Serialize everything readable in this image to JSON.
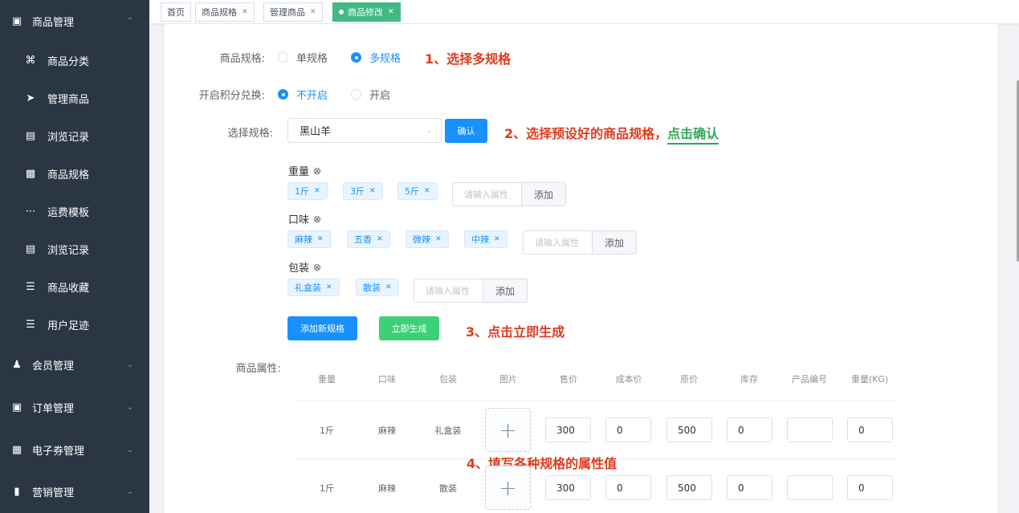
{
  "sidebar": {
    "top_group": {
      "label": "商品管理",
      "icon": "box-icon"
    },
    "sub_items": [
      {
        "label": "商品分类",
        "icon": "category-icon"
      },
      {
        "label": "管理商品",
        "icon": "send-icon"
      },
      {
        "label": "浏览记录",
        "icon": "history-icon"
      },
      {
        "label": "商品规格",
        "icon": "monitor-icon"
      },
      {
        "label": "运费模板",
        "icon": "shrink-icon"
      },
      {
        "label": "浏览记录",
        "icon": "history-icon"
      },
      {
        "label": "商品收藏",
        "icon": "menu-icon"
      },
      {
        "label": "用户足迹",
        "icon": "list-icon"
      }
    ],
    "groups": [
      {
        "label": "会员管理",
        "icon": "users-icon"
      },
      {
        "label": "订单管理",
        "icon": "lock-icon"
      },
      {
        "label": "电子券管理",
        "icon": "coupon-icon"
      },
      {
        "label": "营销管理",
        "icon": "chart-icon"
      }
    ]
  },
  "tabs": [
    {
      "label": "首页",
      "closable": false
    },
    {
      "label": "商品规格",
      "closable": true
    },
    {
      "label": "管理商品",
      "closable": true
    },
    {
      "label": "商品修改",
      "closable": true,
      "active": true
    }
  ],
  "form": {
    "spec_type_label": "商品规格:",
    "spec_type_options": [
      "单规格",
      "多规格"
    ],
    "spec_type_selected": "多规格",
    "points_label": "开启积分兑换:",
    "points_options": [
      "不开启",
      "开启"
    ],
    "points_selected": "不开启",
    "choose_spec_label": "选择规格:",
    "choose_spec_value": "黑山羊",
    "confirm_label": "确认",
    "specs": [
      {
        "name": "重量",
        "values": [
          "1斤",
          "3斤",
          "5斤"
        ]
      },
      {
        "name": "口味",
        "values": [
          "麻辣",
          "五香",
          "微辣",
          "中辣"
        ]
      },
      {
        "name": "包装",
        "values": [
          "礼盒装",
          "散装"
        ]
      }
    ],
    "attr_placeholder": "请输入属性",
    "add_label": "添加",
    "add_spec_label": "添加新规格",
    "generate_label": "立即生成",
    "attrs_label": "商品属性:"
  },
  "annotations": {
    "a1": "1、选择多规格",
    "a2_prefix": "2、选择预设好的商品规格，",
    "a2_highlight": "点击确认",
    "a3": "3、点击立即生成",
    "a4": "4、填写各种规格的属性值"
  },
  "table": {
    "headers": [
      "重量",
      "口味",
      "包装",
      "图片",
      "售价",
      "成本价",
      "原价",
      "库存",
      "产品编号",
      "重量(KG)"
    ],
    "rows": [
      {
        "weight": "1斤",
        "flavor": "麻辣",
        "pack": "礼盒装",
        "price": "300",
        "cost": "0",
        "orig": "500",
        "stock": "0",
        "code": "",
        "kg": "0"
      },
      {
        "weight": "1斤",
        "flavor": "麻辣",
        "pack": "散装",
        "price": "300",
        "cost": "0",
        "orig": "500",
        "stock": "0",
        "code": "",
        "kg": "0"
      }
    ]
  },
  "colors": {
    "sidebar_bg": "#2b3644",
    "primary": "#1890ff",
    "success": "#3dd177",
    "annotation": "#e03b1e",
    "active_tab": "#42b983"
  }
}
